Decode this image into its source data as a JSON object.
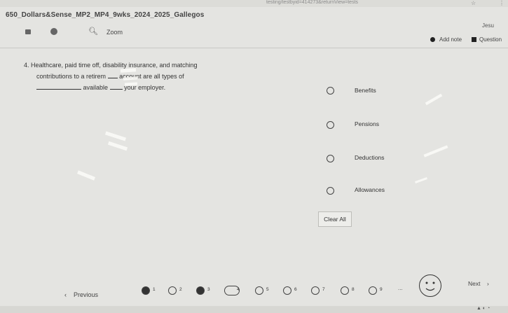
{
  "browser": {
    "url_fragment": "testing/testbyid=414273&returnView=tests"
  },
  "header": {
    "course_title": "650_Dollars&Sense_MP2_MP4_9wks_2024_2025_Gallegos",
    "user_name": "Jesu"
  },
  "toolbar": {
    "zoom_label": "Zoom",
    "add_note_label": "Add note",
    "question_label": "Question"
  },
  "question": {
    "number": "4.",
    "line1": "Healthcare, paid time off, disability insurance, and matching",
    "line2_a": "contributions to a retirem",
    "line2_b": "account are all types of",
    "line3_b": "available",
    "line3_c": "your employer."
  },
  "options": [
    {
      "label": "Benefits"
    },
    {
      "label": "Pensions"
    },
    {
      "label": "Deductions"
    },
    {
      "label": "Allowances"
    }
  ],
  "clear_label": "Clear All",
  "nav": {
    "previous_label": "Previous",
    "next_label": "Next",
    "chevron_left": "‹",
    "chevron_right": "›",
    "ellipsis": "...",
    "pages": [
      {
        "num": "1",
        "state": "answered"
      },
      {
        "num": "2",
        "state": "unanswered"
      },
      {
        "num": "3",
        "state": "answered"
      },
      {
        "num": "4",
        "state": "current"
      },
      {
        "num": "5",
        "state": "unanswered"
      },
      {
        "num": "6",
        "state": "unanswered"
      },
      {
        "num": "7",
        "state": "unanswered"
      },
      {
        "num": "8",
        "state": "unanswered"
      },
      {
        "num": "9",
        "state": "unanswered"
      }
    ]
  },
  "icons": {
    "zoom": "search-icon",
    "add_note": "note-icon",
    "question": "flag-icon",
    "star": "star-icon"
  }
}
